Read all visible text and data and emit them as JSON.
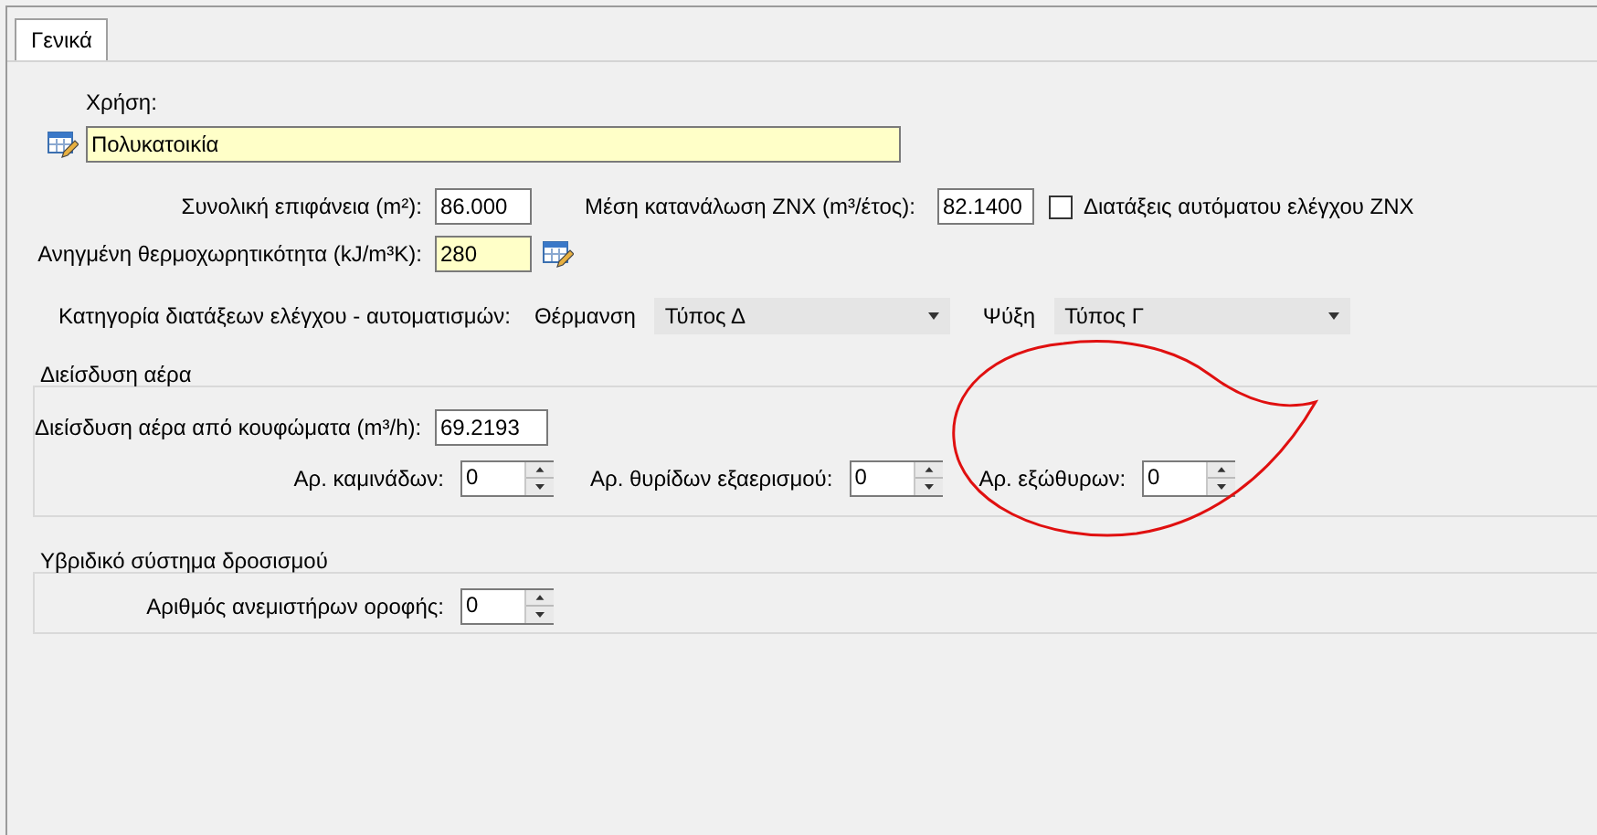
{
  "tabs": [
    {
      "label": "Γενικά",
      "selected": true
    }
  ],
  "usage": {
    "label": "Χρήση:",
    "value": "Πολυκατοικία",
    "highlighted": true
  },
  "surface": {
    "label": "Συνολική επιφάνεια (m²):",
    "value": "86.000",
    "highlighted": false
  },
  "dhw": {
    "label": "Μέση κατανάλωση ZNX (m³/έτος):",
    "value": "82.1400",
    "highlighted": false
  },
  "dhw_auto": {
    "label": "Διατάξεις αυτόματου ελέγχου ZNX",
    "checked": false
  },
  "heat_capacity": {
    "label": "Ανηγμένη θερμοχωρητικότητα (kJ/m³K):",
    "value": "280",
    "highlighted": true
  },
  "control_category": {
    "label": "Κατηγορία διατάξεων ελέγχου - αυτοματισμών:",
    "heating": {
      "label": "Θέρμανση",
      "value": "Τύπος Δ"
    },
    "cooling": {
      "label": "Ψύξη",
      "value": "Τύπος Γ"
    }
  },
  "air_infiltration": {
    "title": "Διείσδυση αέρα",
    "openings": {
      "label": "Διείσδυση αέρα από κουφώματα (m³/h):",
      "value": "69.2193",
      "highlighted": false
    },
    "counters": [
      {
        "label": "Αρ. καμινάδων:",
        "value": "0"
      },
      {
        "label": "Αρ. θυρίδων εξαερισμού:",
        "value": "0"
      },
      {
        "label": "Αρ. εξώθυρων:",
        "value": "0"
      }
    ]
  },
  "hybrid_cooling": {
    "title": "Υβριδικό σύστημα δροσισμού",
    "counters": [
      {
        "label": "Αριθμός ανεμιστήρων οροφής:",
        "value": "0"
      }
    ]
  }
}
